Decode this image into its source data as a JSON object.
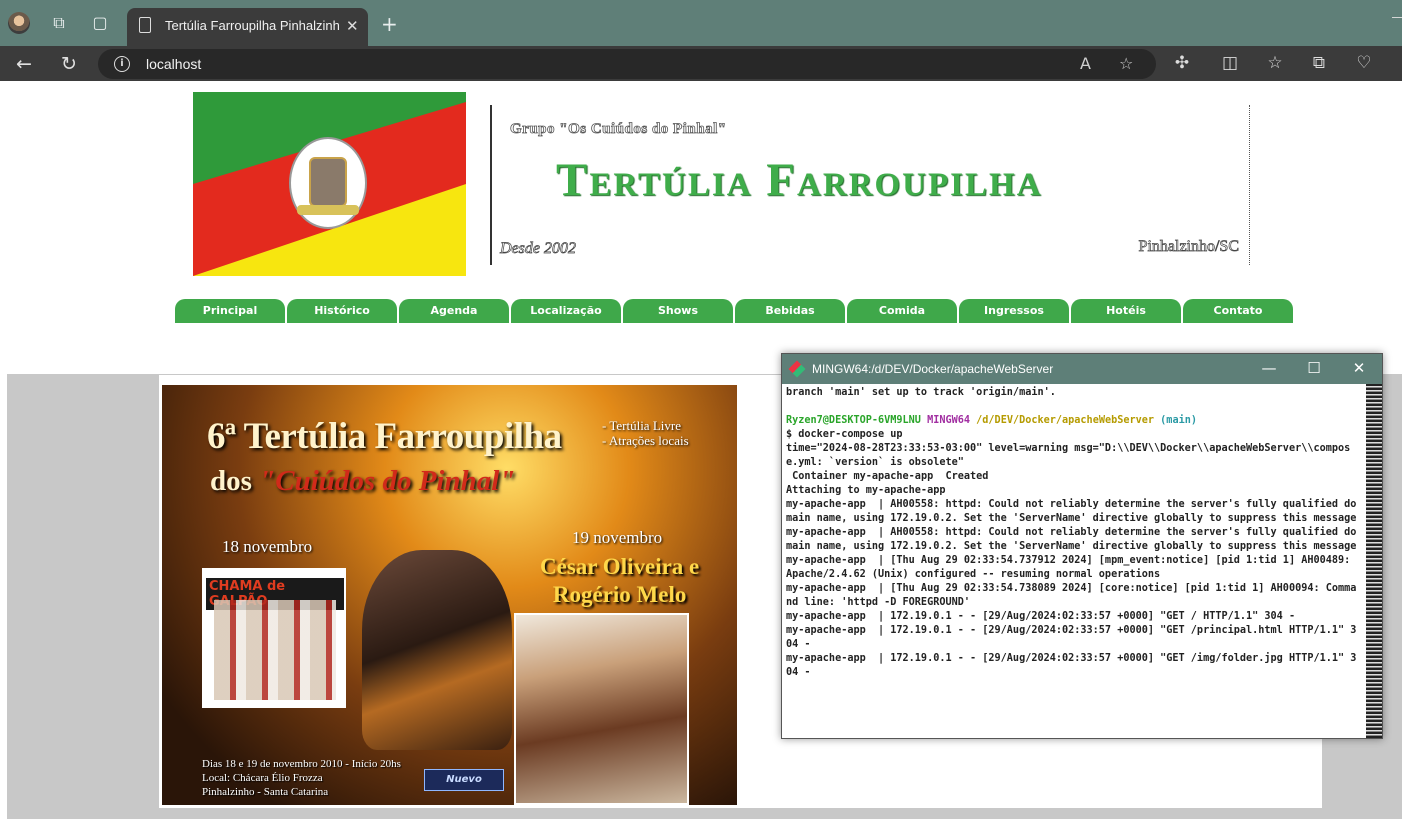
{
  "browser": {
    "tab_title": "Tertúlia Farroupilha Pinhalzinho",
    "tab_close": "✕",
    "new_tab": "+",
    "url": "localhost",
    "window_minimize": "—"
  },
  "icons": [
    "avatar",
    "workspaces-icon",
    "tab-actions-icon",
    "back-icon",
    "refresh-icon",
    "info-icon",
    "read-aloud-icon",
    "favorite-icon",
    "extensions-icon",
    "split-screen-icon",
    "favorites-icon",
    "collections-icon",
    "performance-icon"
  ],
  "header": {
    "group": "Grupo \"Os Cuiúdos do Pinhal\"",
    "title": "Tertúlia Farroupilha",
    "since": "Desde 2002",
    "city": "Pinhalzinho/SC"
  },
  "menu": [
    {
      "label": "Principal"
    },
    {
      "label": "Histórico"
    },
    {
      "label": "Agenda"
    },
    {
      "label": "Localização"
    },
    {
      "label": "Shows"
    },
    {
      "label": "Bebidas"
    },
    {
      "label": "Comida"
    },
    {
      "label": "Ingressos"
    },
    {
      "label": "Hotéis"
    },
    {
      "label": "Contato"
    }
  ],
  "poster": {
    "title_line1": "6ª Tertúlia Farroupilha",
    "title_line2_prefix": "dos ",
    "title_line2_highlight": "\"Cuiúdos do Pinhal\"",
    "extras": [
      "- Tertúlia Livre",
      "- Atrações locais"
    ],
    "date_18": "18 novembro",
    "band": "CHAMA de GALPÃO",
    "date_19": "19 novembro",
    "artist_line1": "César Oliveira e",
    "artist_line2": "Rogério Melo",
    "info_line1": "Dias 18 e 19 de novembro 2010 - Início 20hs",
    "info_line2": "Local: Chácara Élio Frozza",
    "info_line3": "Pinhalzinho - Santa Catarina",
    "sponsor": "Nuevo"
  },
  "terminal": {
    "title": "MINGW64:/d/DEV/Docker/apacheWebServer",
    "buttons": {
      "minimize": "—",
      "maximize": "☐",
      "close": "✕"
    },
    "line_branch": "branch 'main' set up to track 'origin/main'.",
    "prompt_user": "Ryzen7@DESKTOP-6VM9LNU",
    "prompt_sys": "MINGW64",
    "prompt_path": "/d/DEV/Docker/apacheWebServer",
    "prompt_branch": "(main)",
    "command": "$ docker-compose up",
    "output": "time=\"2024-08-28T23:33:53-03:00\" level=warning msg=\"D:\\\\DEV\\\\Docker\\\\apacheWebServer\\\\compose.yml: `version` is obsolete\"\n Container my-apache-app  Created\nAttaching to my-apache-app\nmy-apache-app  | AH00558: httpd: Could not reliably determine the server's fully qualified domain name, using 172.19.0.2. Set the 'ServerName' directive globally to suppress this message\nmy-apache-app  | AH00558: httpd: Could not reliably determine the server's fully qualified domain name, using 172.19.0.2. Set the 'ServerName' directive globally to suppress this message\nmy-apache-app  | [Thu Aug 29 02:33:54.737912 2024] [mpm_event:notice] [pid 1:tid 1] AH00489: Apache/2.4.62 (Unix) configured -- resuming normal operations\nmy-apache-app  | [Thu Aug 29 02:33:54.738089 2024] [core:notice] [pid 1:tid 1] AH00094: Command line: 'httpd -D FOREGROUND'\nmy-apache-app  | 172.19.0.1 - - [29/Aug/2024:02:33:57 +0000] \"GET / HTTP/1.1\" 304 -\nmy-apache-app  | 172.19.0.1 - - [29/Aug/2024:02:33:57 +0000] \"GET /principal.html HTTP/1.1\" 304 -\nmy-apache-app  | 172.19.0.1 - - [29/Aug/2024:02:33:57 +0000] \"GET /img/folder.jpg HTTP/1.1\" 304 -"
  }
}
